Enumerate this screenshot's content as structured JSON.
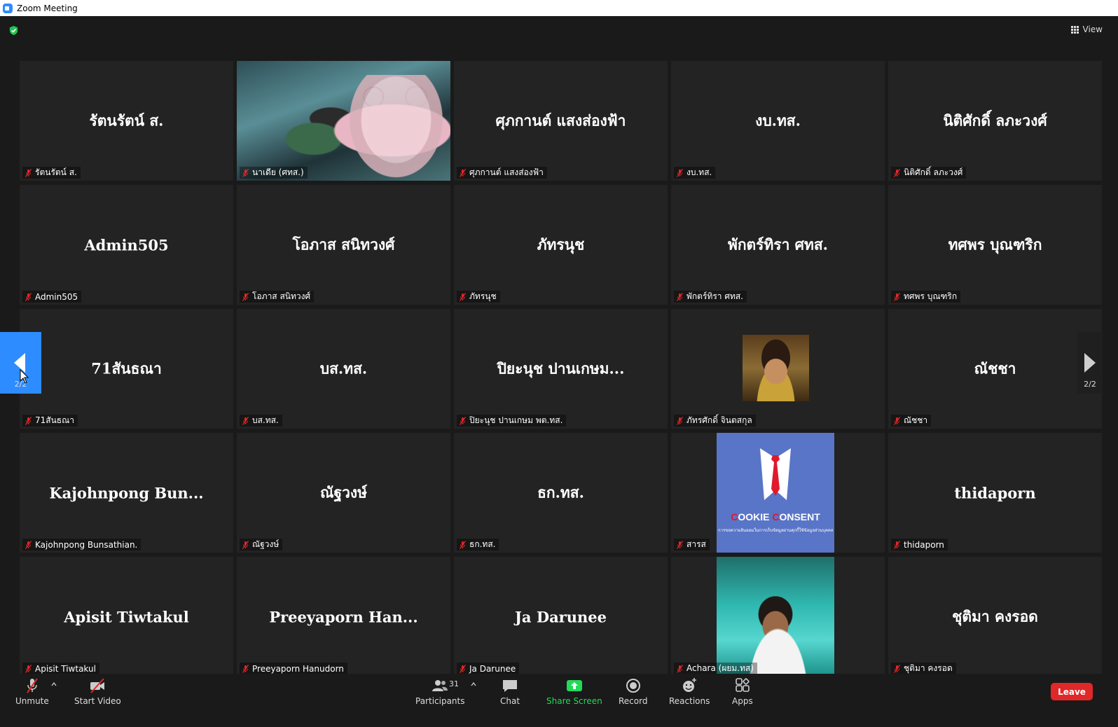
{
  "window": {
    "title": "Zoom Meeting"
  },
  "top": {
    "view_label": "View"
  },
  "tiles": [
    {
      "display": "รัตนรัตน์  ส.",
      "label": "รัตนรัตน์ ส."
    },
    {
      "display": "",
      "label": "นาเดีย (ศทส.)",
      "video": "anime-avatar"
    },
    {
      "display": "ศุภกานต์ แสงส่องฟ้า",
      "label": "ศุภกานต์ แสงส่องฟ้า"
    },
    {
      "display": "งบ.ทส.",
      "label": "งบ.ทส."
    },
    {
      "display": "นิติศักดิ์ ลภะวงศ์",
      "label": "นิติศักดิ์ ลภะวงศ์"
    },
    {
      "display": "Admin505",
      "label": "Admin505"
    },
    {
      "display": "โอภาส สนิทวงศ์",
      "label": "โอภาส สนิทวงศ์"
    },
    {
      "display": "ภัทรนุช",
      "label": "ภัทรนุช"
    },
    {
      "display": "พักตร์ทิรา ศทส.",
      "label": "พักตร์ทิรา ศทส."
    },
    {
      "display": "ทศพร บุณฑริก",
      "label": "ทศพร บุณฑริก"
    },
    {
      "display": "71สันธณา",
      "label": "71สันธณา"
    },
    {
      "display": "บส.ทส.",
      "label": "บส.ทส."
    },
    {
      "display": "ปิยะนุช ปานเกษม...",
      "label": "ปิยะนุช ปานเกษม พต.ทส."
    },
    {
      "display": "",
      "label": "ภัทรศักดิ์ จินตสกุล",
      "video": "person-photo"
    },
    {
      "display": "ณัชชา",
      "label": "ณัชชา"
    },
    {
      "display": "Kajohnpong  Bun...",
      "label": "Kajohnpong Bunsathian."
    },
    {
      "display": "ณัฐวงษ์",
      "label": "ณัฐวงษ์"
    },
    {
      "display": "ธก.ทส.",
      "label": "ธก.ทส."
    },
    {
      "display": "",
      "label": "สารส",
      "video": "cookie-consent"
    },
    {
      "display": "thidaporn",
      "label": "thidaporn"
    },
    {
      "display": "Apisit Tiwtakul",
      "label": "Apisit Tiwtakul"
    },
    {
      "display": "Preeyaporn  Han...",
      "label": "Preeyaporn Hanudorn"
    },
    {
      "display": "Ja Darunee",
      "label": "Ja Darunee"
    },
    {
      "display": "",
      "label": "Achara (ผยม.ทส)",
      "video": "person-photo"
    },
    {
      "display": "ชุติมา คงรอด",
      "label": "ชุติมา คงรอด"
    }
  ],
  "cookie": {
    "title_c": "C",
    "title_ookie": "OOKIE ",
    "title_c2": "C",
    "title_onsent": "ONSENT",
    "subtitle": "การขอความยินยอมในการเก็บข้อมูลผ่านคุกกี้ใช้ข้อมูลส่วนบุคคล"
  },
  "nav": {
    "left_page": "2/2",
    "right_page": "2/2"
  },
  "toolbar": {
    "unmute": "Unmute",
    "start_video": "Start Video",
    "participants": "Participants",
    "participants_count": "31",
    "chat": "Chat",
    "share_screen": "Share Screen",
    "record": "Record",
    "reactions": "Reactions",
    "apps": "Apps",
    "leave": "Leave"
  },
  "colors": {
    "accent_blue": "#2d8cff",
    "share_green": "#23d959",
    "leave_red": "#e02828",
    "muted_red": "#e02828"
  }
}
